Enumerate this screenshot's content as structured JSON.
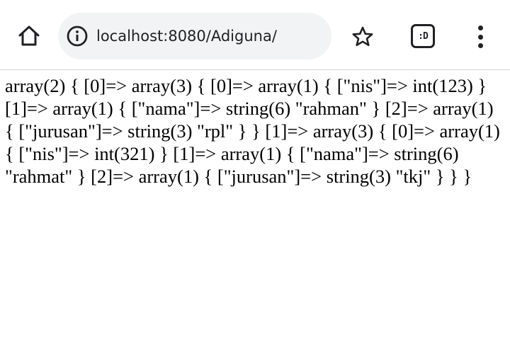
{
  "browser": {
    "address_bar": {
      "url": "localhost:8080/Adiguna/"
    },
    "tab_switcher": {
      "label": ":D"
    },
    "icons": {
      "home": "home-icon",
      "info": "info-icon",
      "bookmark": "star-icon",
      "menu": "more-vert-icon"
    }
  },
  "page": {
    "output": "array(2) { [0]=> array(3) { [0]=> array(1) { [\"nis\"]=> int(123) } [1]=> array(1) { [\"nama\"]=> string(6) \"rahman\" } [2]=> array(1) { [\"jurusan\"]=> string(3) \"rpl\" } } [1]=> array(3) { [0]=> array(1) { [\"nis\"]=> int(321) } [1]=> array(1) { [\"nama\"]=> string(6) \"rahmat\" } [2]=> array(1) { [\"jurusan\"]=> string(3) \"tkj\" } } }"
  }
}
